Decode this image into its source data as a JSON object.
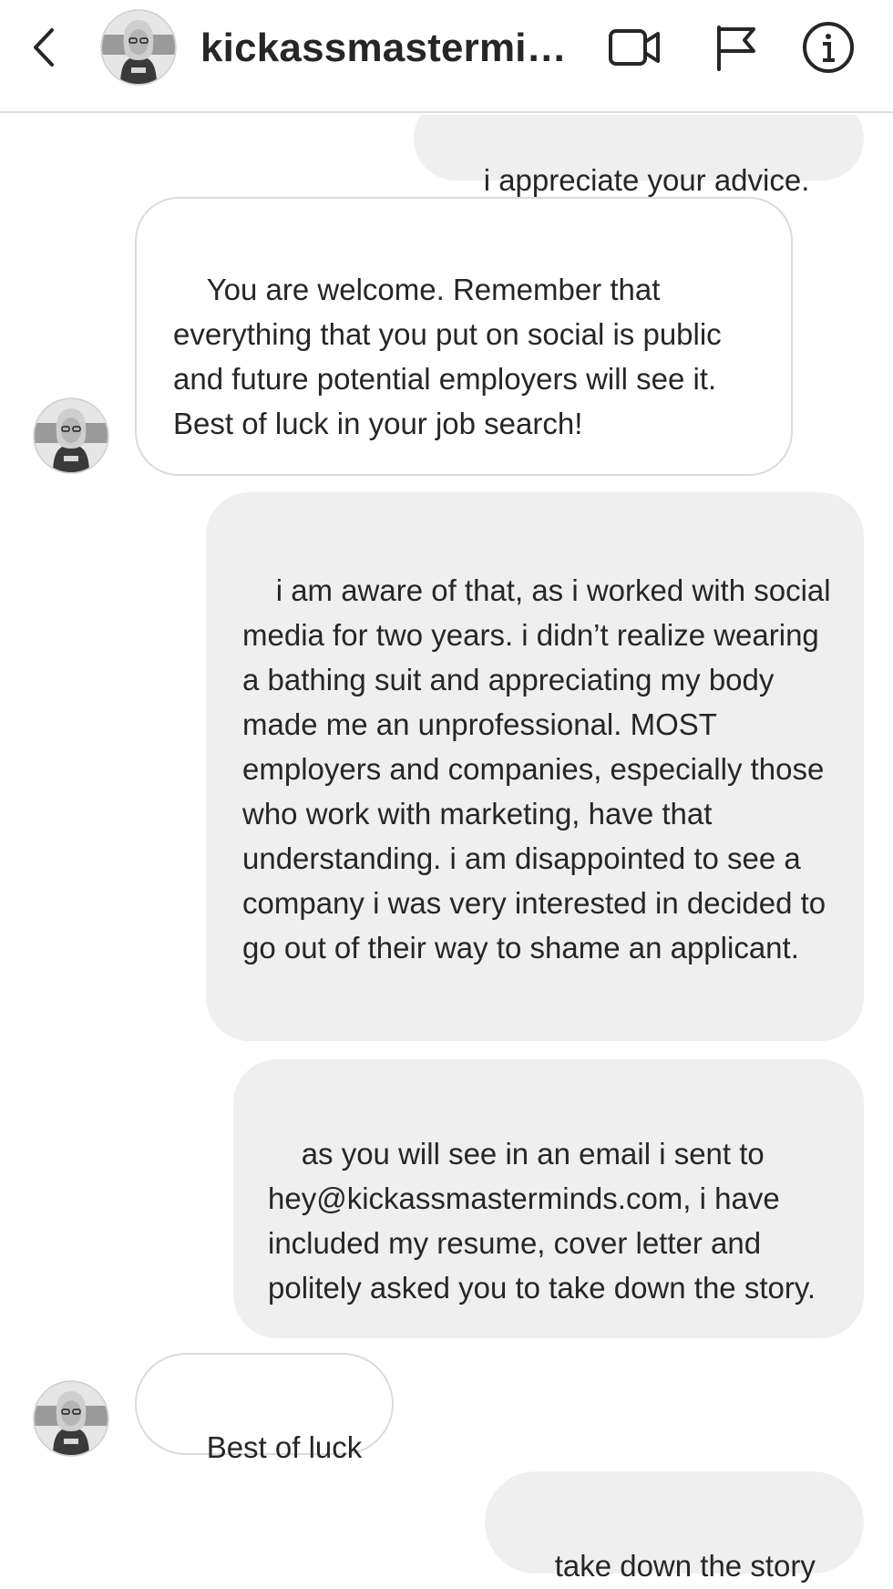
{
  "header": {
    "username": "kickassmastermin...",
    "icons": {
      "back": "chevron-left-icon",
      "video": "video-camera-icon",
      "flag": "flag-icon",
      "info": "info-icon"
    }
  },
  "messages": [
    {
      "direction": "outgoing",
      "text": "i appreciate your advice."
    },
    {
      "direction": "incoming",
      "text": "You are welcome. Remember that everything that you put on social is public and future potential employers will see it. Best of luck in your job search!"
    },
    {
      "direction": "outgoing",
      "text": "i am aware of that, as i worked with social media for two years. i didn’t realize wearing a bathing suit and appreciating my body made me an unprofessional. MOST employers and companies, especially those who work with marketing, have that understanding. i am disappointed to see a company i was very interested in decided to go out of their way to shame an applicant."
    },
    {
      "direction": "outgoing",
      "text": "as you will see in an email i sent to hey@kickassmasterminds.com, i have included my resume, cover letter and politely asked you to take down the story."
    },
    {
      "direction": "incoming",
      "text": "Best of luck"
    },
    {
      "direction": "outgoing",
      "text": "take down the story"
    }
  ],
  "colors": {
    "outgoing_bubble": "#efefef",
    "incoming_border": "#dbdbdb",
    "text": "#262626"
  }
}
